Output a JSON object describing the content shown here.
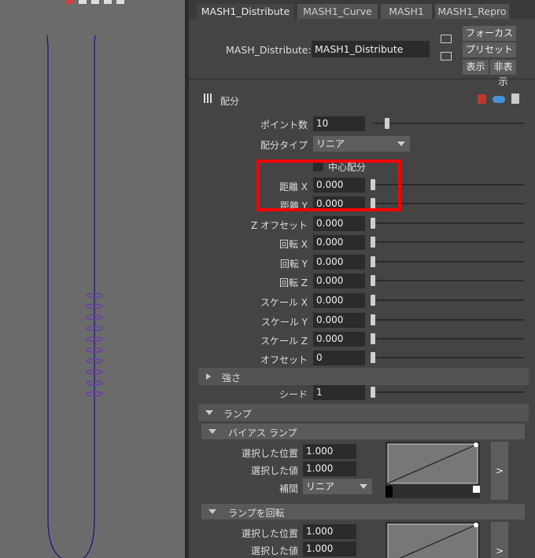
{
  "colors": {
    "accent_red": "#ff0000",
    "curve": "#1a1a7a",
    "dots": "#6f3fa0"
  },
  "tabs": [
    "MASH1_Distribute",
    "MASH1_Curve",
    "MASH1",
    "MASH1_Repro"
  ],
  "node": {
    "label": "MASH_Distribute:",
    "value": "MASH1_Distribute"
  },
  "buttons": {
    "focus": "フォーカス",
    "preset": "プリセット",
    "show": "表示",
    "hide": "非表示"
  },
  "section": {
    "title": "配分"
  },
  "attrs": {
    "points_label": "ポイント数",
    "points_value": "10",
    "dist_type_label": "配分タイプ",
    "dist_type_value": "リニア",
    "center_label": "中心配分",
    "dist_x_label": "距離 X",
    "dist_x_value": "0.000",
    "dist_y_label": "距離 Y",
    "dist_y_value": "0.000",
    "z_offset_label": "Z オフセット",
    "z_offset_value": "0.000",
    "rot_x_label": "回転 X",
    "rot_x_value": "0.000",
    "rot_y_label": "回転 Y",
    "rot_y_value": "0.000",
    "rot_z_label": "回転 Z",
    "rot_z_value": "0.000",
    "scale_x_label": "スケール X",
    "scale_x_value": "0.000",
    "scale_y_label": "スケール Y",
    "scale_y_value": "0.000",
    "scale_z_label": "スケール Z",
    "scale_z_value": "0.000",
    "offset_label": "オフセット",
    "offset_value": "0"
  },
  "strength": {
    "title": "強さ",
    "seed_label": "シード",
    "seed_value": "1"
  },
  "ramp": {
    "title": "ランプ",
    "bias": {
      "title": "バイアス ランプ",
      "sel_pos_label": "選択した位置",
      "sel_pos_value": "1.000",
      "sel_val_label": "選択した値",
      "sel_val_value": "1.000",
      "interp_label": "補間",
      "interp_value": "リニア",
      "expand": ">"
    },
    "rotate": {
      "title": "ランプを回転",
      "sel_pos_label": "選択した位置",
      "sel_pos_value": "1.000",
      "sel_val_label": "選択した値",
      "sel_val_value": "1.000",
      "expand": ">"
    }
  }
}
